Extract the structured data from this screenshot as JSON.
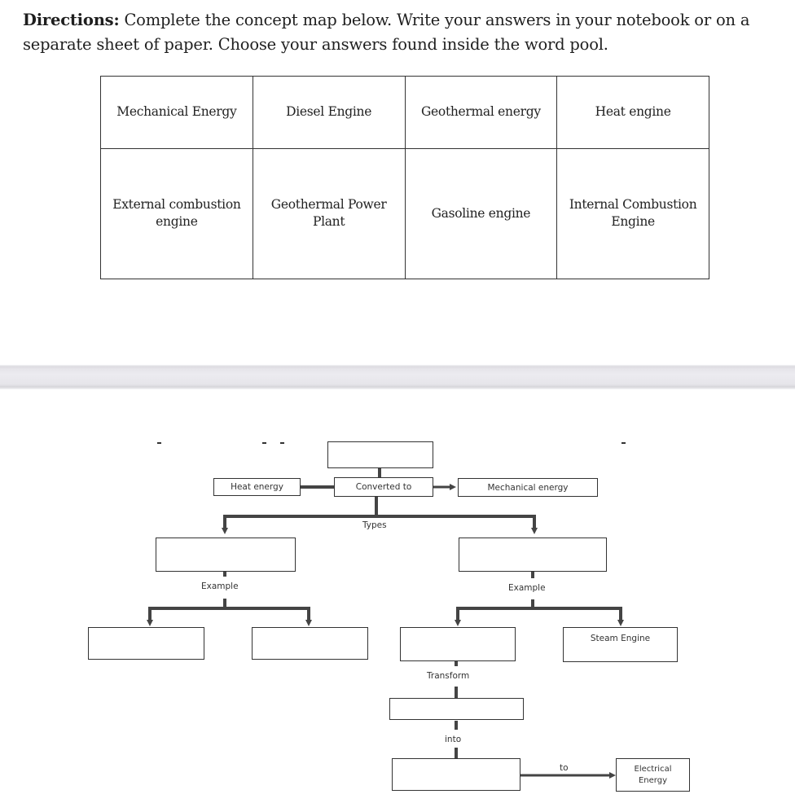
{
  "directions": {
    "label": "Directions:",
    "text": " Complete the concept map below. Write your answers in your notebook or on a separate sheet of paper. Choose your answers found inside the word pool."
  },
  "word_pool": {
    "rows": [
      [
        "Mechanical Energy",
        "Diesel Engine",
        "Geothermal energy",
        "Heat engine"
      ],
      [
        "External combustion engine",
        "Geothermal Power Plant",
        "Gasoline engine",
        "Internal Combustion Engine"
      ]
    ]
  },
  "concept_map": {
    "top_box": "",
    "left_node": "Heat energy",
    "center_node": "Converted to",
    "right_node": "Mechanical energy",
    "types_label": "Types",
    "left_type_box": "",
    "right_type_box": "",
    "left_example_label": "Example",
    "right_example_label": "Example",
    "left_example_1": "",
    "left_example_2": "",
    "right_example_1": "",
    "right_example_2": "Steam Engine",
    "transform_label": "Transform",
    "transform_box": "",
    "into_label": "into",
    "into_box": "",
    "to_label": "to",
    "final_node": "Electrical Energy"
  }
}
